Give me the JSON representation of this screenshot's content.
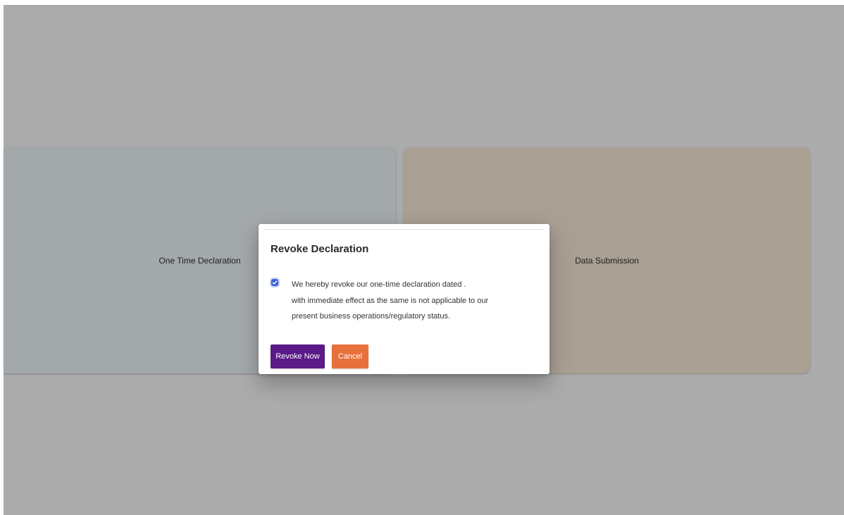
{
  "cards": {
    "left_label": "One Time Declaration",
    "right_label": "Data Submission"
  },
  "modal": {
    "title": "Revoke Declaration",
    "checkbox_checked": true,
    "declaration_lines": [
      "We hereby revoke our one-time declaration dated .",
      "with immediate effect as the same is not applicable to our",
      "present business operations/regulatory status."
    ],
    "revoke_button": "Revoke Now",
    "cancel_button": "Cancel"
  },
  "colors": {
    "overlay": "#ababab",
    "left_card": "#a3a8ab",
    "right_card": "#a99f93",
    "checkbox": "#3f5fd6",
    "revoke_button": "#5a1a87",
    "cancel_button": "#e8703c"
  },
  "icons": {
    "checkbox": "check-icon"
  }
}
